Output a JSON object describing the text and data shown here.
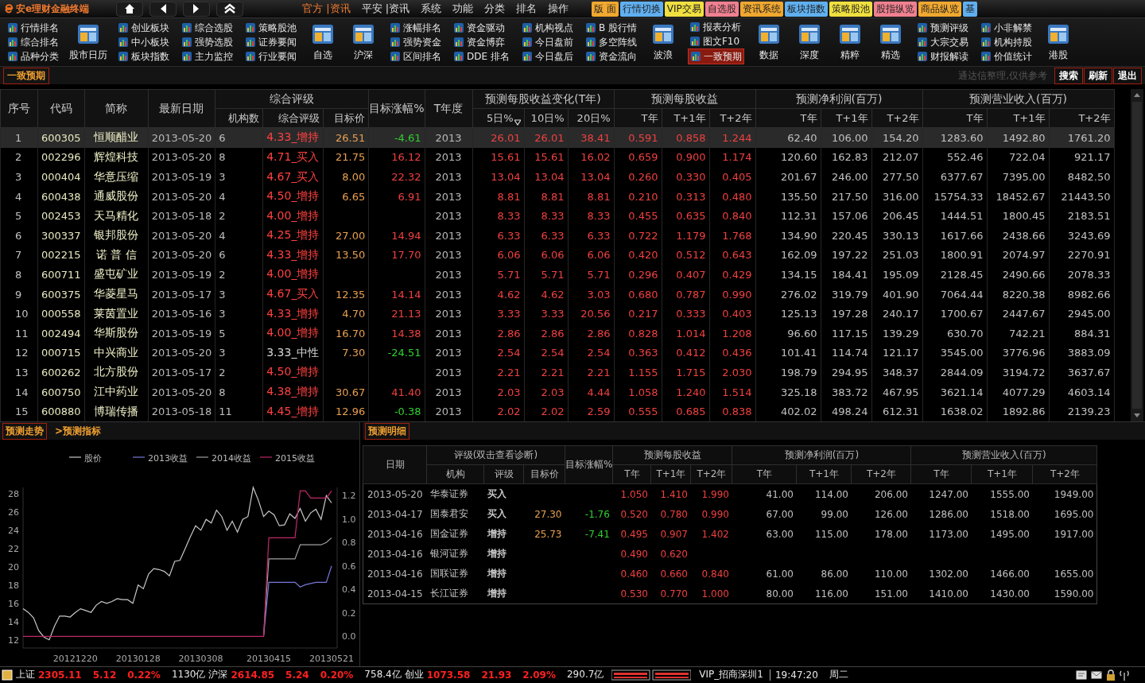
{
  "window": {
    "title": "安e理财金融终端"
  },
  "menu": [
    {
      "label": "官方 |资讯",
      "selected": true
    },
    {
      "label": "平安 |资讯",
      "selected": false
    },
    {
      "label": "系统",
      "selected": false
    },
    {
      "label": "功能",
      "selected": false
    },
    {
      "label": "分类",
      "selected": false
    },
    {
      "label": "排名",
      "selected": false
    },
    {
      "label": "操作",
      "selected": false
    }
  ],
  "quick_tabs": [
    {
      "label": "版 面",
      "color": "#f0a830"
    },
    {
      "label": "行情切换",
      "color": "#60b0f0"
    },
    {
      "label": "VIP交易",
      "color": "#f0e040"
    },
    {
      "label": "自选股",
      "color": "#f08090"
    },
    {
      "label": "资讯系统",
      "color": "#f0a830"
    },
    {
      "label": "板块指数",
      "color": "#60b0f0"
    },
    {
      "label": "策略股池",
      "color": "#f0e040"
    },
    {
      "label": "股指纵览",
      "color": "#f08090"
    },
    {
      "label": "商品纵览",
      "color": "#f0a830"
    },
    {
      "label": "基",
      "color": "#60b0f0"
    }
  ],
  "toolbar": [
    {
      "kind": "stack",
      "items": [
        {
          "label": "行情排名",
          "selected": false
        },
        {
          "label": "综合排名",
          "selected": false
        },
        {
          "label": "品种分类",
          "selected": false
        }
      ]
    },
    {
      "kind": "big",
      "label": "股市日历"
    },
    {
      "kind": "stack",
      "items": [
        {
          "label": "创业板块",
          "selected": false
        },
        {
          "label": "中小板块",
          "selected": false
        },
        {
          "label": "板块指数",
          "selected": false
        }
      ]
    },
    {
      "kind": "stack",
      "items": [
        {
          "label": "综合选股",
          "selected": false
        },
        {
          "label": "强势选股",
          "selected": false
        },
        {
          "label": "主力监控",
          "selected": false
        }
      ]
    },
    {
      "kind": "stack",
      "items": [
        {
          "label": "策略股池",
          "selected": false
        },
        {
          "label": "证券要闻",
          "selected": false
        },
        {
          "label": "行业要闻",
          "selected": false
        }
      ]
    },
    {
      "kind": "big",
      "label": "自选"
    },
    {
      "kind": "big",
      "label": "沪深"
    },
    {
      "kind": "stack",
      "items": [
        {
          "label": "涨幅排名",
          "selected": false
        },
        {
          "label": "强势资金",
          "selected": false
        },
        {
          "label": "区间排名",
          "selected": false
        }
      ]
    },
    {
      "kind": "stack",
      "items": [
        {
          "label": "资金驱动",
          "selected": false
        },
        {
          "label": "资金博弈",
          "selected": false
        },
        {
          "label": "DDE 排名",
          "selected": false
        }
      ]
    },
    {
      "kind": "stack",
      "items": [
        {
          "label": "机构视点",
          "selected": false
        },
        {
          "label": "今日盘前",
          "selected": false
        },
        {
          "label": "今日盘后",
          "selected": false
        }
      ]
    },
    {
      "kind": "stack",
      "items": [
        {
          "label": "B 股行情",
          "selected": false
        },
        {
          "label": "多空阵线",
          "selected": false
        },
        {
          "label": "资金流向",
          "selected": false
        }
      ]
    },
    {
      "kind": "big",
      "label": "波浪"
    },
    {
      "kind": "stack",
      "items": [
        {
          "label": "报表分析",
          "selected": false
        },
        {
          "label": "图文F10",
          "selected": false
        },
        {
          "label": "一致预期",
          "selected": true
        }
      ]
    },
    {
      "kind": "big",
      "label": "数据"
    },
    {
      "kind": "big",
      "label": "深度"
    },
    {
      "kind": "big",
      "label": "精粹"
    },
    {
      "kind": "big",
      "label": "精选"
    },
    {
      "kind": "stack",
      "items": [
        {
          "label": "预测评级",
          "selected": false
        },
        {
          "label": "大宗交易",
          "selected": false
        },
        {
          "label": "财报解读",
          "selected": false
        }
      ]
    },
    {
      "kind": "stack",
      "items": [
        {
          "label": "小非解禁",
          "selected": false
        },
        {
          "label": "机构持股",
          "selected": false
        },
        {
          "label": "价值统计",
          "selected": false
        }
      ]
    },
    {
      "kind": "big",
      "label": "港股"
    }
  ],
  "page_tab": {
    "label": "一致预期"
  },
  "note": "通达信整理,仅供参考",
  "actions": [
    "搜索",
    "刷新",
    "退出"
  ],
  "table": {
    "headers": [
      {
        "label": "序号"
      },
      {
        "label": "代码"
      },
      {
        "label": "简称"
      },
      {
        "label": "最新日期"
      },
      {
        "label": "综合评级",
        "children": [
          {
            "label": "机构数",
            "sorted": false
          },
          {
            "label": "综合评级",
            "sorted": false
          },
          {
            "label": "目标价",
            "sorted": false
          }
        ]
      },
      {
        "label": "目标涨幅%"
      },
      {
        "label": "T年度"
      },
      {
        "label": "预测每股收益变化(T年)",
        "children": [
          {
            "label": "5日%",
            "sorted": true
          },
          {
            "label": "10日%",
            "sorted": false
          },
          {
            "label": "20日%",
            "sorted": false
          }
        ]
      },
      {
        "label": "预测每股收益",
        "children": [
          {
            "label": "T年",
            "sorted": false
          },
          {
            "label": "T+1年",
            "sorted": false
          },
          {
            "label": "T+2年",
            "sorted": false
          }
        ]
      },
      {
        "label": "预测净利润(百万)",
        "children": [
          {
            "label": "T年",
            "sorted": false
          },
          {
            "label": "T+1年",
            "sorted": false
          },
          {
            "label": "T+2年",
            "sorted": false
          }
        ]
      },
      {
        "label": "预测营业收入(百万)",
        "children": [
          {
            "label": "T年",
            "sorted": false
          },
          {
            "label": "T+1年",
            "sorted": false
          },
          {
            "label": "T+2年",
            "sorted": false
          }
        ]
      }
    ],
    "rows": [
      {
        "selected": true,
        "no": "1",
        "code": "600305",
        "name": "恒顺醋业",
        "date": "2013-05-20",
        "count": "6",
        "rating": "4.33_增持",
        "color": "#ff4040",
        "target": "26.51",
        "upside": "-4.61",
        "upside_down": true,
        "year": "2013",
        "eps_chg": [
          "26.01",
          "26.01",
          "38.41"
        ],
        "eps": [
          "0.591",
          "0.858",
          "1.244"
        ],
        "profit": [
          "62.40",
          "106.00",
          "154.20"
        ],
        "revenue": [
          "1283.60",
          "1492.80",
          "1761.20"
        ]
      },
      {
        "selected": false,
        "no": "2",
        "code": "002296",
        "name": "辉煌科技",
        "date": "2013-05-20",
        "count": "8",
        "rating": "4.71_买入",
        "color": "#ff4040",
        "target": "21.75",
        "upside": "16.12",
        "upside_down": false,
        "year": "2013",
        "eps_chg": [
          "15.61",
          "15.61",
          "16.02"
        ],
        "eps": [
          "0.659",
          "0.900",
          "1.174"
        ],
        "profit": [
          "120.60",
          "162.83",
          "212.07"
        ],
        "revenue": [
          "552.46",
          "722.04",
          "921.17"
        ]
      },
      {
        "selected": false,
        "no": "3",
        "code": "000404",
        "name": "华意压缩",
        "date": "2013-05-19",
        "count": "3",
        "rating": "4.67_买入",
        "color": "#ff4040",
        "target": "8.00",
        "upside": "22.32",
        "upside_down": false,
        "year": "2013",
        "eps_chg": [
          "13.04",
          "13.04",
          "13.04"
        ],
        "eps": [
          "0.260",
          "0.330",
          "0.405"
        ],
        "profit": [
          "201.67",
          "246.00",
          "277.50"
        ],
        "revenue": [
          "6377.67",
          "7395.00",
          "8482.50"
        ]
      },
      {
        "selected": false,
        "no": "4",
        "code": "600438",
        "name": "通威股份",
        "date": "2013-05-20",
        "count": "4",
        "rating": "4.50_增持",
        "color": "#ff4040",
        "target": "6.65",
        "upside": "6.91",
        "upside_down": false,
        "year": "2013",
        "eps_chg": [
          "8.81",
          "8.81",
          "8.81"
        ],
        "eps": [
          "0.210",
          "0.313",
          "0.480"
        ],
        "profit": [
          "135.50",
          "217.50",
          "316.00"
        ],
        "revenue": [
          "15754.33",
          "18452.67",
          "21443.50"
        ]
      },
      {
        "selected": false,
        "no": "5",
        "code": "002453",
        "name": "天马精化",
        "date": "2013-05-18",
        "count": "2",
        "rating": "4.00_增持",
        "color": "#ff4040",
        "year": "2013",
        "eps_chg": [
          "8.33",
          "8.33",
          "8.33"
        ],
        "eps": [
          "0.455",
          "0.635",
          "0.840"
        ],
        "profit": [
          "112.31",
          "157.06",
          "206.45"
        ],
        "revenue": [
          "1444.51",
          "1800.45",
          "2183.51"
        ]
      },
      {
        "selected": false,
        "no": "6",
        "code": "300337",
        "name": "银邦股份",
        "date": "2013-05-20",
        "count": "4",
        "rating": "4.25_增持",
        "color": "#ff4040",
        "target": "27.00",
        "upside": "14.94",
        "upside_down": false,
        "year": "2013",
        "eps_chg": [
          "6.33",
          "6.33",
          "6.33"
        ],
        "eps": [
          "0.722",
          "1.179",
          "1.768"
        ],
        "profit": [
          "134.90",
          "220.45",
          "330.13"
        ],
        "revenue": [
          "1617.66",
          "2438.66",
          "3243.69"
        ]
      },
      {
        "selected": false,
        "no": "7",
        "code": "002215",
        "name": "诺 普 信",
        "date": "2013-05-20",
        "count": "6",
        "rating": "4.33_增持",
        "color": "#ff4040",
        "target": "13.50",
        "upside": "17.70",
        "upside_down": false,
        "year": "2013",
        "eps_chg": [
          "6.06",
          "6.06",
          "6.06"
        ],
        "eps": [
          "0.420",
          "0.512",
          "0.643"
        ],
        "profit": [
          "162.09",
          "197.22",
          "251.03"
        ],
        "revenue": [
          "1800.91",
          "2074.97",
          "2270.91"
        ]
      },
      {
        "selected": false,
        "no": "8",
        "code": "600711",
        "name": "盛屯矿业",
        "date": "2013-05-19",
        "count": "2",
        "rating": "4.00_增持",
        "color": "#ff4040",
        "year": "2013",
        "eps_chg": [
          "5.71",
          "5.71",
          "5.71"
        ],
        "eps": [
          "0.296",
          "0.407",
          "0.429"
        ],
        "profit": [
          "134.15",
          "184.41",
          "195.09"
        ],
        "revenue": [
          "2128.45",
          "2490.66",
          "2078.33"
        ]
      },
      {
        "selected": false,
        "no": "9",
        "code": "600375",
        "name": "华菱星马",
        "date": "2013-05-17",
        "count": "3",
        "rating": "4.67_买入",
        "color": "#ff4040",
        "target": "12.35",
        "upside": "14.14",
        "upside_down": false,
        "year": "2013",
        "eps_chg": [
          "4.62",
          "4.62",
          "3.03"
        ],
        "eps": [
          "0.680",
          "0.787",
          "0.990"
        ],
        "profit": [
          "276.02",
          "319.79",
          "401.90"
        ],
        "revenue": [
          "7064.44",
          "8220.38",
          "8982.66"
        ]
      },
      {
        "selected": false,
        "no": "10",
        "code": "000558",
        "name": "莱茵置业",
        "date": "2013-05-16",
        "count": "3",
        "rating": "4.33_增持",
        "color": "#ff4040",
        "target": "4.70",
        "upside": "21.13",
        "upside_down": false,
        "year": "2013",
        "eps_chg": [
          "3.33",
          "3.33",
          "20.56"
        ],
        "eps": [
          "0.217",
          "0.333",
          "0.403"
        ],
        "profit": [
          "125.13",
          "197.28",
          "240.17"
        ],
        "revenue": [
          "1700.67",
          "2447.67",
          "2945.00"
        ]
      },
      {
        "selected": false,
        "no": "11",
        "code": "002494",
        "name": "华斯股份",
        "date": "2013-05-19",
        "count": "5",
        "rating": "4.00_增持",
        "color": "#ff4040",
        "target": "16.70",
        "upside": "14.38",
        "upside_down": false,
        "year": "2013",
        "eps_chg": [
          "2.86",
          "2.86",
          "2.86"
        ],
        "eps": [
          "0.828",
          "1.014",
          "1.208"
        ],
        "profit": [
          "96.60",
          "117.15",
          "139.29"
        ],
        "revenue": [
          "630.70",
          "742.21",
          "884.31"
        ]
      },
      {
        "selected": false,
        "no": "12",
        "code": "000715",
        "name": "中兴商业",
        "date": "2013-05-20",
        "count": "3",
        "rating": "3.33_中性",
        "color": "#d8d8d8",
        "target": "7.30",
        "upside": "-24.51",
        "upside_down": true,
        "year": "2013",
        "eps_chg": [
          "2.54",
          "2.54",
          "2.54"
        ],
        "eps": [
          "0.363",
          "0.412",
          "0.436"
        ],
        "profit": [
          "101.41",
          "114.74",
          "121.17"
        ],
        "revenue": [
          "3545.00",
          "3776.96",
          "3883.09"
        ]
      },
      {
        "selected": false,
        "no": "13",
        "code": "600262",
        "name": "北方股份",
        "date": "2013-05-17",
        "count": "2",
        "rating": "4.50_增持",
        "color": "#ff4040",
        "year": "2013",
        "eps_chg": [
          "2.21",
          "2.21",
          "2.21"
        ],
        "eps": [
          "1.155",
          "1.715",
          "2.030"
        ],
        "profit": [
          "198.79",
          "294.95",
          "348.37"
        ],
        "revenue": [
          "2844.09",
          "3194.72",
          "3637.67"
        ]
      },
      {
        "selected": false,
        "no": "14",
        "code": "600750",
        "name": "江中药业",
        "date": "2013-05-20",
        "count": "8",
        "rating": "4.38_增持",
        "color": "#ff4040",
        "target": "30.67",
        "upside": "41.40",
        "upside_down": false,
        "year": "2013",
        "eps_chg": [
          "2.03",
          "2.03",
          "4.44"
        ],
        "eps": [
          "1.058",
          "1.240",
          "1.514"
        ],
        "profit": [
          "325.18",
          "383.72",
          "467.95"
        ],
        "revenue": [
          "3621.14",
          "4077.29",
          "4603.14"
        ]
      },
      {
        "selected": false,
        "no": "15",
        "code": "600880",
        "name": "博瑞传播",
        "date": "2013-05-18",
        "count": "11",
        "rating": "4.45_增持",
        "color": "#ff4040",
        "target": "12.96",
        "upside": "-0.38",
        "upside_down": true,
        "year": "2013",
        "eps_chg": [
          "2.02",
          "2.02",
          "2.59"
        ],
        "eps": [
          "0.555",
          "0.685",
          "0.838"
        ],
        "profit": [
          "402.02",
          "498.24",
          "612.31"
        ],
        "revenue": [
          "1638.02",
          "1892.86",
          "2139.23"
        ]
      }
    ]
  },
  "forecast_panel": {
    "tabs": [
      {
        "label": "预测走势",
        "selected": true
      },
      {
        "label": ">预测指标",
        "selected": false
      }
    ],
    "chart_data": {
      "type": "line",
      "legend": "top",
      "categories": [
        null,
        null,
        null,
        null,
        null,
        null,
        null,
        null,
        null,
        null,
        "20121220",
        null,
        null,
        null,
        null,
        null,
        null,
        null,
        null,
        null,
        null,
        null,
        "20130128",
        null,
        null,
        null,
        null,
        null,
        null,
        null,
        null,
        null,
        null,
        null,
        "20130308",
        null,
        null,
        null,
        null,
        null,
        null,
        null,
        null,
        null,
        null,
        null,
        null,
        "20130415",
        null,
        null,
        null,
        null,
        null,
        null,
        null,
        null,
        null,
        null,
        null,
        "20130521"
      ],
      "ylim": [
        11.1,
        28.7
      ],
      "yticks": [
        12,
        14,
        16,
        18,
        20,
        22,
        24,
        26,
        28
      ],
      "y2lim": [
        -0.1,
        1.27
      ],
      "y2ticks": [
        {
          "value": 0,
          "label": "0.0"
        },
        {
          "value": 0.2,
          "label": "0.2"
        },
        {
          "value": 0.4,
          "label": "0.4"
        },
        {
          "value": 0.6,
          "label": "0.6"
        },
        {
          "value": 0.8,
          "label": "0.8"
        },
        {
          "value": 1.0,
          "label": "1.0"
        },
        {
          "value": 1.2,
          "label": "1.2"
        }
      ],
      "series": [
        {
          "name": "股价",
          "color": "#c8c8c8",
          "values": [
            15.4,
            15.0,
            14.4,
            13.0,
            12.3,
            12.0,
            13.5,
            14.6,
            14.6,
            14.5,
            15.0,
            15.4,
            15.2,
            15.0,
            15.8,
            16.2,
            16.0,
            16.2,
            16.5,
            16.4,
            16.4,
            16.0,
            18.0,
            17.6,
            19.2,
            19.8,
            19.7,
            19.5,
            19.0,
            20.6,
            20.7,
            22.0,
            23.3,
            24.5,
            24.0,
            25.2,
            24.8,
            26.2,
            25.5,
            24.0,
            25.0,
            23.8,
            25.2,
            25.5,
            28.7,
            27.3,
            25.5,
            26.1,
            25.7,
            24.5,
            24.6,
            25.8,
            25.3,
            26.4,
            25.0,
            25.9,
            26.3,
            25.2,
            27.8,
            27.0
          ]
        },
        {
          "name": "2013收益",
          "color": "#7878d8",
          "axis": "y2",
          "values": [
            null,
            null,
            null,
            null,
            null,
            null,
            null,
            null,
            null,
            null,
            null,
            null,
            null,
            null,
            null,
            null,
            null,
            null,
            null,
            null,
            null,
            null,
            null,
            null,
            null,
            null,
            null,
            null,
            null,
            null,
            null,
            null,
            null,
            null,
            null,
            null,
            null,
            null,
            null,
            null,
            null,
            null,
            null,
            null,
            null,
            null,
            0,
            0.46,
            0.46,
            0.46,
            0.46,
            0.46,
            0.46,
            0.42,
            0.44,
            0.45,
            0.46,
            0.46,
            0.46,
            0.6
          ]
        },
        {
          "name": "2014收益",
          "color": "#a0a0a0",
          "axis": "y2",
          "values": [
            null,
            null,
            null,
            null,
            null,
            null,
            null,
            null,
            null,
            null,
            null,
            null,
            null,
            null,
            null,
            null,
            null,
            null,
            null,
            null,
            null,
            null,
            null,
            null,
            null,
            null,
            null,
            null,
            null,
            null,
            null,
            null,
            null,
            null,
            null,
            null,
            null,
            null,
            null,
            null,
            null,
            null,
            null,
            null,
            null,
            null,
            0,
            0.66,
            0.66,
            0.66,
            0.66,
            0.66,
            0.66,
            0.78,
            0.78,
            0.78,
            0.78,
            0.78,
            0.8,
            0.84
          ]
        },
        {
          "name": "2015收益",
          "color": "#c02868",
          "axis": "y2",
          "values": [
            0,
            0,
            0,
            0,
            0,
            0,
            0,
            0,
            0,
            0,
            0,
            0,
            0,
            0,
            0,
            0,
            0,
            0,
            0,
            0,
            0,
            0,
            0,
            0,
            0,
            0,
            0,
            0,
            0,
            0,
            0,
            0,
            0,
            0,
            0,
            0,
            0,
            0,
            0,
            0,
            0,
            0,
            0,
            0,
            0,
            0,
            0,
            0.84,
            0.84,
            0.84,
            0.84,
            0.84,
            0.84,
            1.24,
            1.24,
            1.18,
            1.18,
            1.18,
            1.18,
            1.24
          ]
        }
      ]
    }
  },
  "detail": {
    "tab": {
      "label": "预测明细"
    },
    "headers": [
      {
        "label": "日期"
      },
      {
        "label": "评级(双击查看诊断)",
        "children": [
          "机构",
          "评级",
          "目标价"
        ]
      },
      {
        "label": "目标涨幅%"
      },
      {
        "label": "预测每股收益",
        "children": [
          "T年",
          "T+1年",
          "T+2年"
        ]
      },
      {
        "label": "预测净利润(百万)",
        "children": [
          "T年",
          "T+1年",
          "T+2年"
        ]
      },
      {
        "label": "预测营业收入(百万)",
        "children": [
          "T年",
          "T+1年",
          "T+2年"
        ]
      }
    ],
    "rows": [
      {
        "date": "2013-05-20",
        "broker": "华泰证券",
        "rating": "买入",
        "eps": [
          "1.050",
          "1.410",
          "1.990"
        ],
        "profit": [
          "41.00",
          "114.00",
          "206.00"
        ],
        "revenue": [
          "1247.00",
          "1555.00",
          "1949.00"
        ]
      },
      {
        "date": "2013-04-17",
        "broker": "国泰君安",
        "rating": "买入",
        "target": "27.30",
        "upside": "-1.76",
        "upside_down": true,
        "eps": [
          "0.520",
          "0.780",
          "0.990"
        ],
        "profit": [
          "67.00",
          "99.00",
          "126.00"
        ],
        "revenue": [
          "1286.00",
          "1518.00",
          "1695.00"
        ]
      },
      {
        "date": "2013-04-16",
        "broker": "国金证券",
        "rating": "增持",
        "target": "25.73",
        "upside": "-7.41",
        "upside_down": true,
        "eps": [
          "0.495",
          "0.907",
          "1.402"
        ],
        "profit": [
          "63.00",
          "115.00",
          "178.00"
        ],
        "revenue": [
          "1173.00",
          "1495.00",
          "1917.00"
        ]
      },
      {
        "date": "2013-04-16",
        "broker": "银河证券",
        "rating": "增持",
        "eps": [
          "0.490",
          "0.620"
        ]
      },
      {
        "date": "2013-04-16",
        "broker": "国联证券",
        "rating": "增持",
        "eps": [
          "0.460",
          "0.660",
          "0.840"
        ],
        "profit": [
          "61.00",
          "86.00",
          "110.00"
        ],
        "revenue": [
          "1302.00",
          "1466.00",
          "1655.00"
        ]
      },
      {
        "date": "2013-04-15",
        "broker": "长江证券",
        "rating": "增持",
        "eps": [
          "0.530",
          "0.770",
          "1.000"
        ],
        "profit": [
          "80.00",
          "116.00",
          "151.00"
        ],
        "revenue": [
          "1410.00",
          "1430.00",
          "1590.00"
        ]
      }
    ]
  },
  "status_bar": {
    "indices": [
      {
        "name": "上证",
        "value": "2305.11",
        "change": "5.12",
        "pct": "0.22%",
        "amount": "1130亿"
      },
      {
        "name": "沪深",
        "value": "2614.85",
        "change": "5.24",
        "pct": "0.20%",
        "amount": "758.4亿"
      },
      {
        "name": "创业",
        "value": "1073.58",
        "change": "21.93",
        "pct": "2.09%",
        "amount": "290.7亿"
      }
    ],
    "account": "VIP_招商深圳1",
    "time": "19:47:20",
    "weekday": "周二"
  }
}
